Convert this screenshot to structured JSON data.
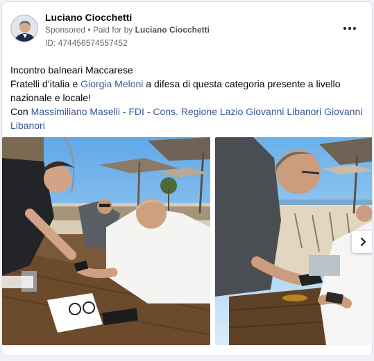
{
  "post": {
    "author": "Luciano Ciocchetti",
    "sponsored_label": "Sponsored",
    "separator": "•",
    "paid_for_prefix": "Paid for by",
    "paid_for_name": "Luciano Ciocchetti",
    "id_text": "ID: 474456574557452",
    "more_icon": "more-horizontal-icon"
  },
  "body": {
    "line1": "Incontro balneari Maccarese",
    "line2_a": "Fratelli d’italia e ",
    "line2_link": "Giorgia Meloni",
    "line2_b": " a difesa di questa categoria presente a livello nazionale e locale!",
    "line3_prefix": "Con ",
    "line3_link1": "Massimiliano Maselli - FDI - Cons. Regione Lazio",
    "line3_space": " ",
    "line3_link2": "Giovanni Libanori",
    "line3_link3": "Giovanni Libanori"
  },
  "carousel": {
    "next_icon": "chevron-right-icon",
    "photo_count": 2
  },
  "colors": {
    "link": "#385898",
    "secondary_text": "#65676b",
    "card_bg": "#ffffff"
  }
}
